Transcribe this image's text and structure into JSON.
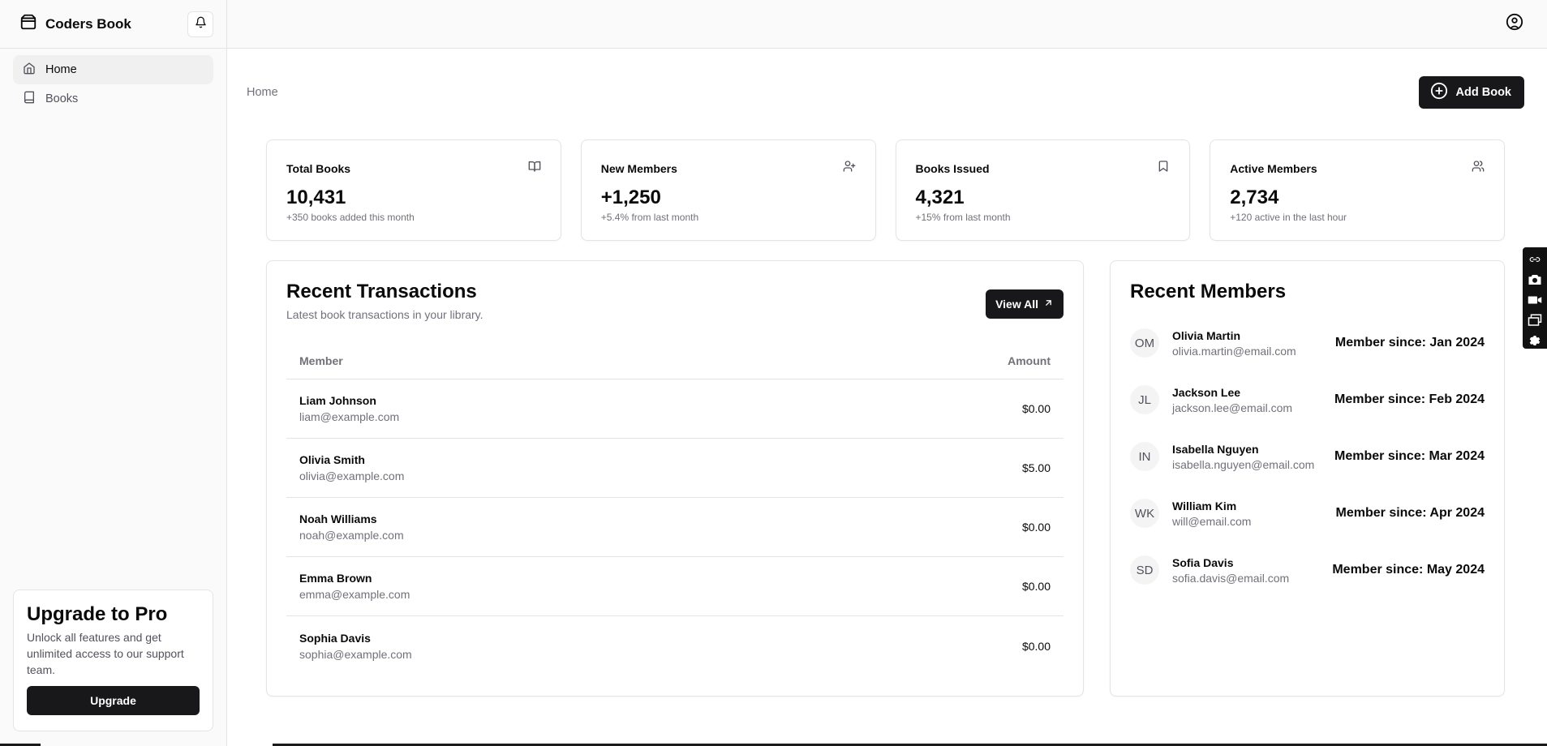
{
  "brand": {
    "name": "Coders Book"
  },
  "nav": [
    {
      "label": "Home",
      "icon": "home-icon",
      "active": true
    },
    {
      "label": "Books",
      "icon": "book-icon",
      "active": false
    }
  ],
  "upgrade": {
    "title": "Upgrade to Pro",
    "description": "Unlock all features and get unlimited access to our support team.",
    "button_label": "Upgrade"
  },
  "header": {
    "breadcrumb": "Home",
    "add_button_label": "Add Book"
  },
  "stats": [
    {
      "title": "Total Books",
      "value": "10,431",
      "sub": "+350 books added this month",
      "icon": "book-open-icon"
    },
    {
      "title": "New Members",
      "value": "+1,250",
      "sub": "+5.4% from last month",
      "icon": "user-plus-icon"
    },
    {
      "title": "Books Issued",
      "value": "4,321",
      "sub": "+15% from last month",
      "icon": "bookmark-icon"
    },
    {
      "title": "Active Members",
      "value": "2,734",
      "sub": "+120 active in the last hour",
      "icon": "users-icon"
    }
  ],
  "transactions": {
    "title": "Recent Transactions",
    "description": "Latest book transactions in your library.",
    "view_all_label": "View All",
    "columns": {
      "member": "Member",
      "amount": "Amount"
    },
    "rows": [
      {
        "name": "Liam Johnson",
        "email": "liam@example.com",
        "amount": "$0.00"
      },
      {
        "name": "Olivia Smith",
        "email": "olivia@example.com",
        "amount": "$5.00"
      },
      {
        "name": "Noah Williams",
        "email": "noah@example.com",
        "amount": "$0.00"
      },
      {
        "name": "Emma Brown",
        "email": "emma@example.com",
        "amount": "$0.00"
      },
      {
        "name": "Sophia Davis",
        "email": "sophia@example.com",
        "amount": "$0.00"
      }
    ]
  },
  "members": {
    "title": "Recent Members",
    "rows": [
      {
        "initials": "OM",
        "name": "Olivia Martin",
        "email": "olivia.martin@email.com",
        "since": "Member since: Jan 2024"
      },
      {
        "initials": "JL",
        "name": "Jackson Lee",
        "email": "jackson.lee@email.com",
        "since": "Member since: Feb 2024"
      },
      {
        "initials": "IN",
        "name": "Isabella Nguyen",
        "email": "isabella.nguyen@email.com",
        "since": "Member since: Mar 2024"
      },
      {
        "initials": "WK",
        "name": "William Kim",
        "email": "will@email.com",
        "since": "Member since: Apr 2024"
      },
      {
        "initials": "SD",
        "name": "Sofia Davis",
        "email": "sofia.davis@email.com",
        "since": "Member since: May 2024"
      }
    ]
  },
  "floating_toolbar": [
    "link-icon",
    "camera-icon",
    "video-icon",
    "windows-icon",
    "gear-icon"
  ]
}
